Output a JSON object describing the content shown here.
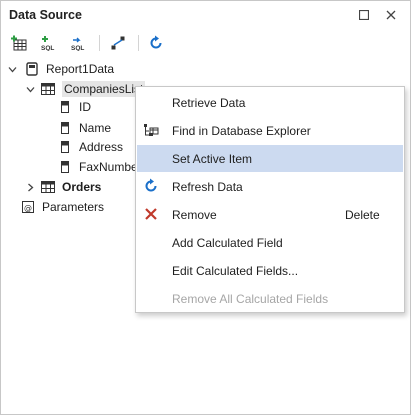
{
  "panel": {
    "title": "Data Source"
  },
  "window_controls": {
    "maximize_icon": "maximize-icon",
    "close_icon": "close-icon"
  },
  "toolbar": {
    "buttons": [
      {
        "name": "add-data-source-button",
        "icon": "add-table-icon"
      },
      {
        "name": "add-sql-query-button",
        "icon": "add-sql-icon"
      },
      {
        "name": "edit-sql-query-button",
        "icon": "edit-sql-icon"
      },
      {
        "name": "manage-relations-button",
        "icon": "relations-icon"
      },
      {
        "name": "refresh-button",
        "icon": "refresh-icon"
      }
    ]
  },
  "tree": {
    "root": "Report1Data",
    "companies": "CompaniesList",
    "fields": [
      "ID",
      "Name",
      "Address",
      "FaxNumber"
    ],
    "orders": "Orders",
    "parameters": "Parameters"
  },
  "context_menu": {
    "items": [
      {
        "label": "Retrieve Data",
        "shortcut": "",
        "icon": "",
        "active": false,
        "disabled": false
      },
      {
        "label": "Find in Database Explorer",
        "shortcut": "",
        "icon": "database-explorer-icon",
        "active": false,
        "disabled": false
      },
      {
        "label": "Set Active Item",
        "shortcut": "",
        "icon": "",
        "active": true,
        "disabled": false
      },
      {
        "label": "Refresh Data",
        "shortcut": "",
        "icon": "refresh-icon",
        "active": false,
        "disabled": false
      },
      {
        "label": "Remove",
        "shortcut": "Delete",
        "icon": "remove-icon",
        "active": false,
        "disabled": false
      },
      {
        "label": "Add Calculated Field",
        "shortcut": "",
        "icon": "",
        "active": false,
        "disabled": false
      },
      {
        "label": "Edit Calculated Fields...",
        "shortcut": "",
        "icon": "",
        "active": false,
        "disabled": false
      },
      {
        "label": "Remove All Calculated Fields",
        "shortcut": "",
        "icon": "",
        "active": false,
        "disabled": true
      }
    ]
  },
  "colors": {
    "accent_blue": "#1a6fc9",
    "highlight": "#ccdaf0",
    "remove_red": "#c0392b",
    "sql_green": "#2e9e44"
  }
}
